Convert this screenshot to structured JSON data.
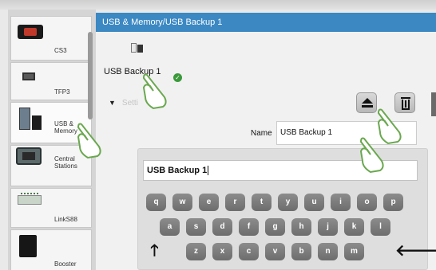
{
  "sidebar": {
    "items": [
      {
        "label": "CS3",
        "icon": "cs3-device-icon"
      },
      {
        "label": "TFP3",
        "icon": "tfp3-device-icon"
      },
      {
        "label": "USB &\nMemory",
        "icon": "usb-memory-icon"
      },
      {
        "label": "Central\nStations",
        "icon": "central-station-icon"
      },
      {
        "label": "LinkS88",
        "icon": "links88-device-icon"
      },
      {
        "label": "Booster",
        "icon": "booster-device-icon"
      }
    ],
    "active_label": "USB & Memory"
  },
  "header": {
    "title": "USB & Memory/USB  Backup 1"
  },
  "device": {
    "name": "USB  Backup 1",
    "status_icon": "checkmark-icon",
    "status_color": "#3a9a3a"
  },
  "settings": {
    "label": "Setti"
  },
  "actions": {
    "eject_icon": "eject-icon",
    "trash_icon": "trash-icon"
  },
  "name_field": {
    "label": "Name",
    "value": "USB  Backup 1"
  },
  "keyboard": {
    "input_value": "USB  Backup 1",
    "row1": [
      "q",
      "w",
      "e",
      "r",
      "t",
      "y",
      "u",
      "i",
      "o",
      "p"
    ],
    "row2": [
      "a",
      "s",
      "d",
      "f",
      "g",
      "h",
      "j",
      "k",
      "l"
    ],
    "row3": [
      "z",
      "x",
      "c",
      "v",
      "b",
      "n",
      "m"
    ],
    "shift_glyph": "🡑",
    "backspace_glyph": "🡐"
  },
  "colors": {
    "header_blue": "#3b88c3",
    "finger_green": "#6aa84f"
  }
}
